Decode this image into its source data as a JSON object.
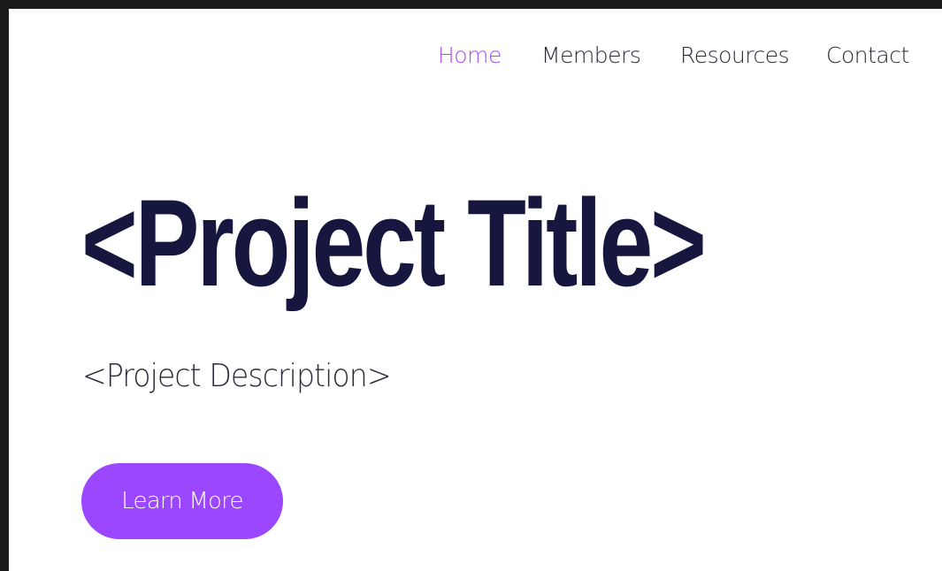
{
  "nav": {
    "items": [
      {
        "label": "Home",
        "active": true
      },
      {
        "label": "Members",
        "active": false
      },
      {
        "label": "Resources",
        "active": false
      },
      {
        "label": "Contact",
        "active": false
      }
    ],
    "active_color": "#a64dff",
    "text_color": "#2a2a3a"
  },
  "hero": {
    "title": "<Project Title>",
    "description": "<Project Description>",
    "cta_label": "Learn More",
    "title_color": "#16163f",
    "cta_color": "#9a47ff"
  }
}
